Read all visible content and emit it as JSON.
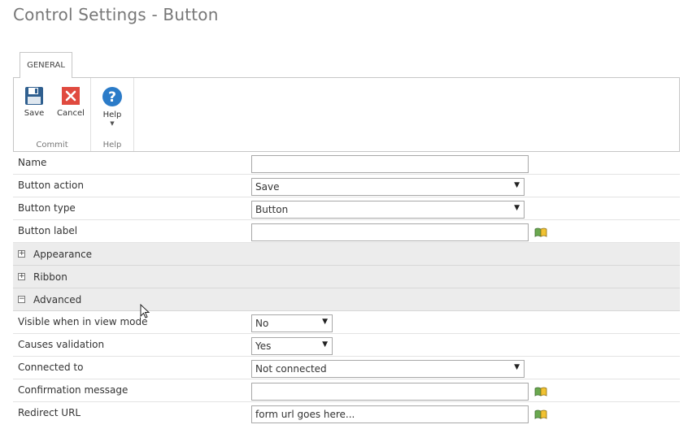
{
  "page": {
    "title": "Control Settings - Button"
  },
  "ribbon": {
    "tab": "GENERAL",
    "groups": {
      "commit": {
        "label": "Commit",
        "save": "Save",
        "cancel": "Cancel"
      },
      "help": {
        "label": "Help",
        "help": "Help"
      }
    }
  },
  "form": {
    "rows": [
      {
        "label": "Name",
        "value": ""
      },
      {
        "label": "Button action",
        "value": "Save"
      },
      {
        "label": "Button type",
        "value": "Button"
      },
      {
        "label": "Button label",
        "value": ""
      }
    ],
    "sections": {
      "appearance": {
        "title": "Appearance",
        "toggle": "+"
      },
      "ribbon": {
        "title": "Ribbon",
        "toggle": "+"
      },
      "advanced": {
        "title": "Advanced",
        "toggle": "−"
      }
    },
    "advanced_rows": [
      {
        "label": "Visible when in view mode",
        "value": "No"
      },
      {
        "label": "Causes validation",
        "value": "Yes"
      },
      {
        "label": "Connected to",
        "value": "Not connected"
      },
      {
        "label": "Confirmation message",
        "value": ""
      },
      {
        "label": "Redirect URL",
        "value": "form url goes here..."
      }
    ]
  },
  "colors": {
    "save_icon": "#2f5f8f",
    "cancel_icon": "#e04a3f",
    "help_icon": "#2b7bc8"
  }
}
